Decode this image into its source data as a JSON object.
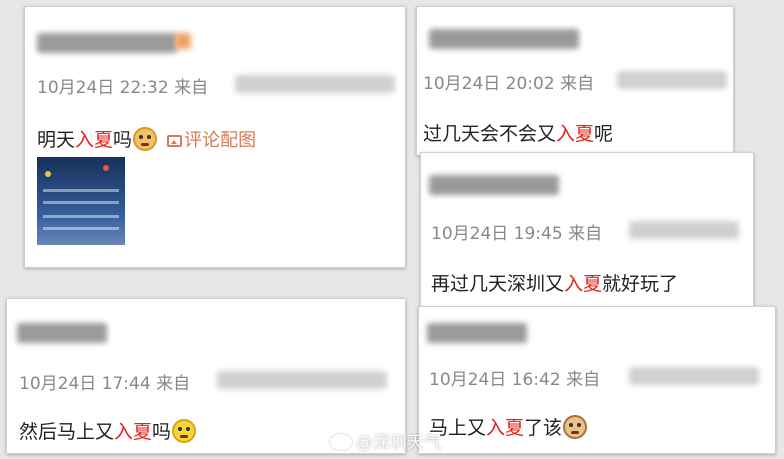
{
  "highlight_color": "#e2231a",
  "posts": [
    {
      "timestamp": "10月24日 22:32",
      "source_label": "来自",
      "text_before": "明天",
      "highlight": "入夏",
      "text_after": "吗",
      "emoji": "doge-emoji",
      "link_text": "评论配图"
    },
    {
      "timestamp": "10月24日 20:02",
      "source_label": "来自",
      "text_before": "过几天会不会又",
      "highlight": "入夏",
      "text_after": "呢"
    },
    {
      "timestamp": "10月24日 19:45",
      "source_label": "来自",
      "text_before": "再过几天深圳又",
      "highlight": "入夏",
      "text_after": "就好玩了"
    },
    {
      "timestamp": "10月24日 17:44",
      "source_label": "来自",
      "text_before": "然后马上又",
      "highlight": "入夏",
      "text_after": "吗",
      "emoji": "laugh-cry-emoji"
    },
    {
      "timestamp": "10月24日 16:42",
      "source_label": "来自",
      "text_before": "马上又",
      "highlight": "入夏",
      "text_after": "了该",
      "emoji": "cat-emoji"
    }
  ],
  "watermark": "@深圳天气"
}
